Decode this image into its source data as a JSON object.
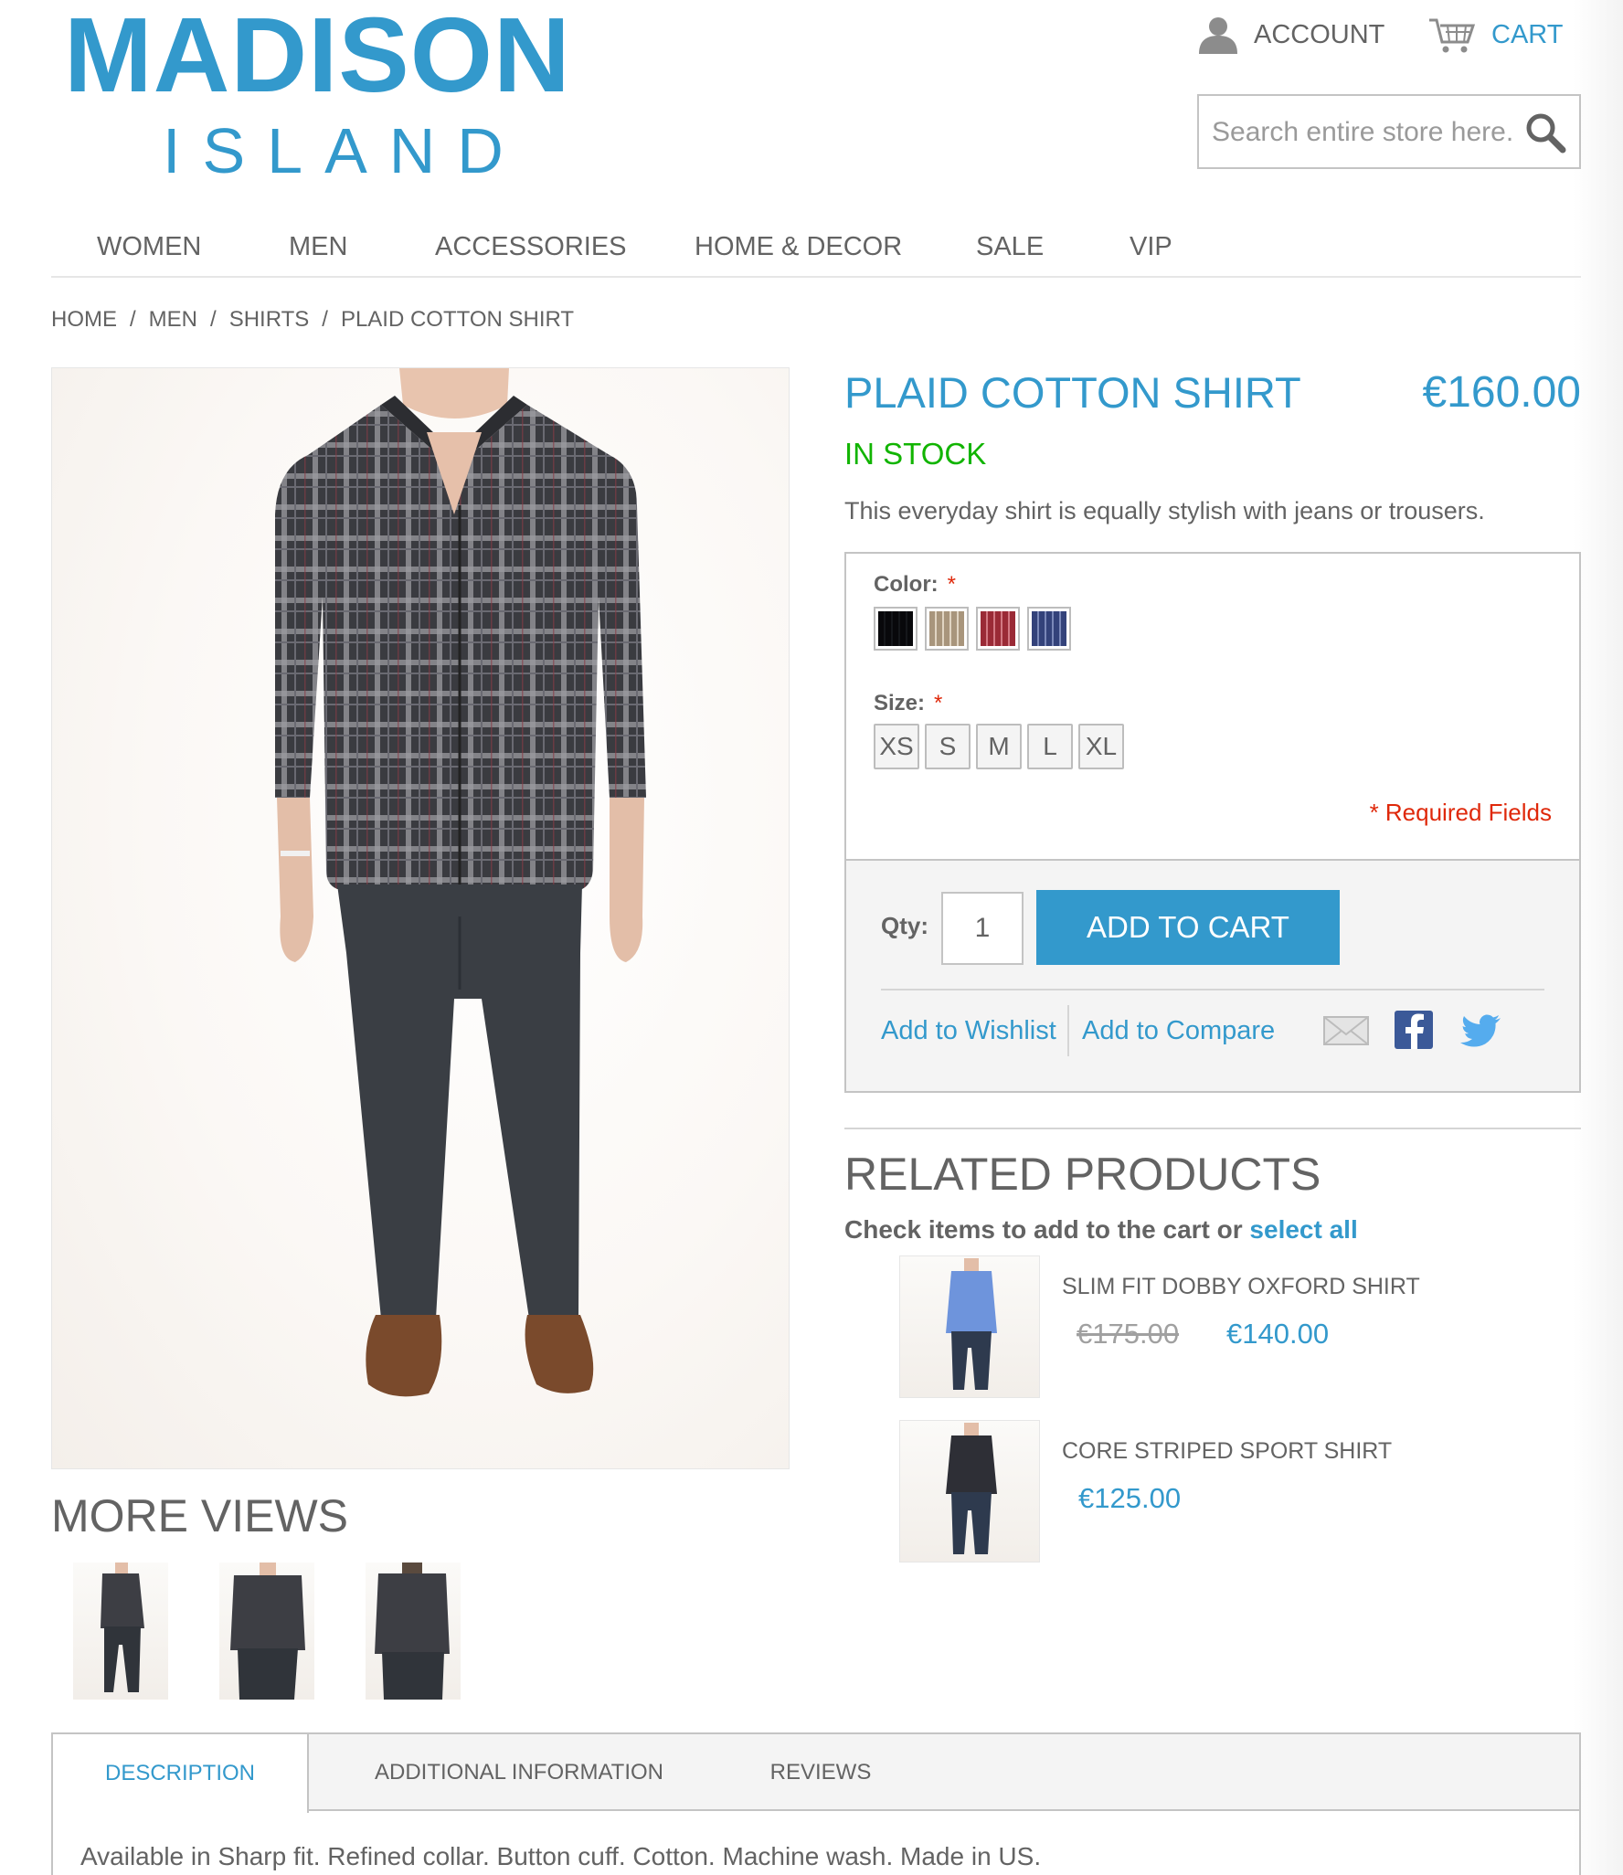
{
  "header": {
    "logo_top": "MADISON",
    "logo_bottom": "ISLAND",
    "account_label": "ACCOUNT",
    "cart_label": "CART",
    "search_placeholder": "Search entire store here..."
  },
  "nav": {
    "items": [
      "WOMEN",
      "MEN",
      "ACCESSORIES",
      "HOME & DECOR",
      "SALE",
      "VIP"
    ]
  },
  "breadcrumb": [
    "HOME",
    "MEN",
    "SHIRTS",
    "PLAID COTTON SHIRT"
  ],
  "product": {
    "name": "PLAID COTTON SHIRT",
    "price": "€160.00",
    "availability": "IN STOCK",
    "short_description": "This everyday shirt is equally stylish with jeans or trousers.",
    "color_label": "Color:",
    "size_label": "Size:",
    "required_mark": "*",
    "colors": [
      {
        "name": "Charcoal",
        "hex": "#3a3d44"
      },
      {
        "name": "Khaki",
        "hex": "#b8a68f"
      },
      {
        "name": "Red",
        "hex": "#a8323e"
      },
      {
        "name": "Blue",
        "hex": "#3f4f86"
      }
    ],
    "sizes": [
      "XS",
      "S",
      "M",
      "L",
      "XL"
    ],
    "required_fields": "* Required Fields",
    "qty_label": "Qty:",
    "qty_value": "1",
    "add_to_cart": "ADD TO CART",
    "add_to_wishlist": "Add to Wishlist",
    "add_to_compare": "Add to Compare"
  },
  "more_views": {
    "title": "MORE VIEWS"
  },
  "related": {
    "title": "RELATED PRODUCTS",
    "check_text": "Check items to add to the cart or",
    "select_all": "select all",
    "items": [
      {
        "name": "SLIM FIT DOBBY OXFORD SHIRT",
        "old_price": "€175.00",
        "price": "€140.00"
      },
      {
        "name": "CORE STRIPED SPORT SHIRT",
        "price": "€125.00"
      }
    ]
  },
  "tabs": {
    "items": [
      "DESCRIPTION",
      "ADDITIONAL INFORMATION",
      "REVIEWS"
    ],
    "description_text": "Available in Sharp fit. Refined collar. Button cuff. Cotton. Machine wash. Made in US."
  },
  "colors": {
    "accent": "#3399cc",
    "in_stock": "#11b400",
    "required": "#df280a",
    "text": "#636363"
  },
  "icons": [
    "account-icon",
    "cart-icon",
    "search-icon",
    "email-icon",
    "facebook-icon",
    "twitter-icon"
  ]
}
